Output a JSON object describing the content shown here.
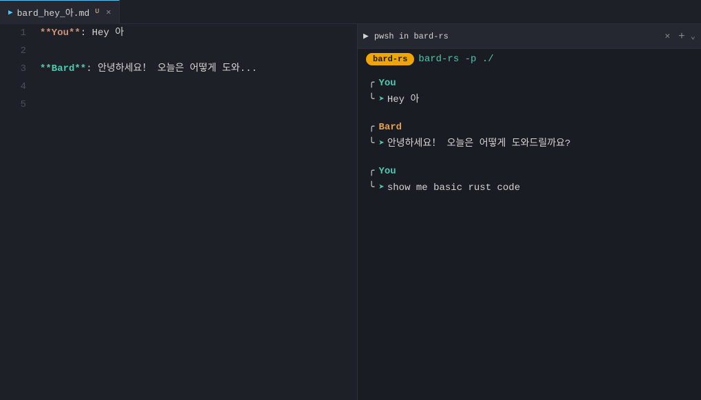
{
  "tabBar": {
    "tab1": {
      "filename": "bard_hey_아.md",
      "modified": "U",
      "active": true
    }
  },
  "editor": {
    "lines": [
      {
        "num": 1,
        "content": "**You**: Hey 아"
      },
      {
        "num": 2,
        "content": ""
      },
      {
        "num": 3,
        "content": "**Bard**: 안녕하세요！ 오늘은 어떻게 도와..."
      },
      {
        "num": 4,
        "content": ""
      },
      {
        "num": 5,
        "content": ""
      }
    ]
  },
  "terminal": {
    "tabTitle": "pwsh in bard-rs",
    "cmdBadge": "bard-rs",
    "cmdText": "bard-rs -p ./",
    "messages": [
      {
        "author": "You",
        "authorType": "you",
        "text": "Hey 아"
      },
      {
        "author": "Bard",
        "authorType": "bard",
        "text": "안녕하세요！ 오늘은 어떻게 도와드릴까요?"
      },
      {
        "author": "You",
        "authorType": "you",
        "text": "show me basic rust code"
      }
    ]
  }
}
